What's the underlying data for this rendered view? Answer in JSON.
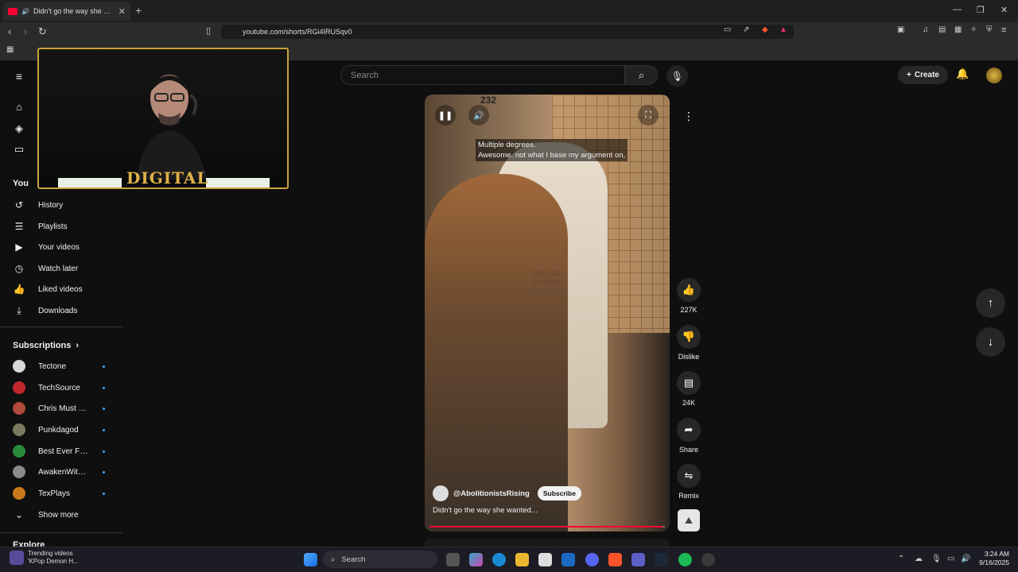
{
  "browser": {
    "tab_title": "Didn't go the way she wanted...",
    "tab_close": "✕",
    "new_tab": "+",
    "url": "youtube.com/shorts/RGi4IRUSqv0",
    "window_controls": [
      "—",
      "❐",
      "✕"
    ]
  },
  "youtube": {
    "search_placeholder": "Search",
    "create_label": "Create",
    "sidebar": {
      "you_label": "You",
      "you_items": [
        {
          "label": "History",
          "icon": "history-icon"
        },
        {
          "label": "Playlists",
          "icon": "playlists-icon"
        },
        {
          "label": "Your videos",
          "icon": "your-videos-icon"
        },
        {
          "label": "Watch later",
          "icon": "watch-later-icon"
        },
        {
          "label": "Liked videos",
          "icon": "like-icon"
        },
        {
          "label": "Downloads",
          "icon": "download-icon"
        }
      ],
      "subscriptions_label": "Subscriptions",
      "subscriptions": [
        {
          "label": "Tectone",
          "color": "#d8d8d8"
        },
        {
          "label": "TechSource",
          "color": "#c0282c"
        },
        {
          "label": "Chris Must List",
          "color": "#b04a3a"
        },
        {
          "label": "Punkdagod",
          "color": "#7a7a60"
        },
        {
          "label": "Best Ever Food R...",
          "color": "#2a8a3a"
        },
        {
          "label": "AwakenWithJP",
          "color": "#8a8a8a"
        },
        {
          "label": "TexPlays",
          "color": "#c87a1a"
        }
      ],
      "show_more_label": "Show more",
      "explore_label": "Explore"
    },
    "stream_overlay": {
      "logo_text": "DIGITAL"
    },
    "short": {
      "counter": "232",
      "captions": [
        "Multiple degrees.",
        "Awesome. not what I base my argument on,"
      ],
      "shirt_text": [
        "ABOLISH",
        "HUMAN",
        "ABORTION"
      ],
      "channel": "@AbolitionistsRising",
      "subscribe_label": "Subscribe",
      "title": "Didn't go the way she wanted...",
      "progress_fraction": 0.99
    },
    "actions": {
      "likes": "227K",
      "dislike": "Dislike",
      "comments": "24K",
      "share": "Share",
      "remix": "Remix"
    }
  },
  "taskbar": {
    "widget_line1": "Trending videos",
    "widget_line2": "'KPop Demon H...",
    "search_label": "Search",
    "time": "3:24 AM",
    "date": "9/16/2025"
  }
}
